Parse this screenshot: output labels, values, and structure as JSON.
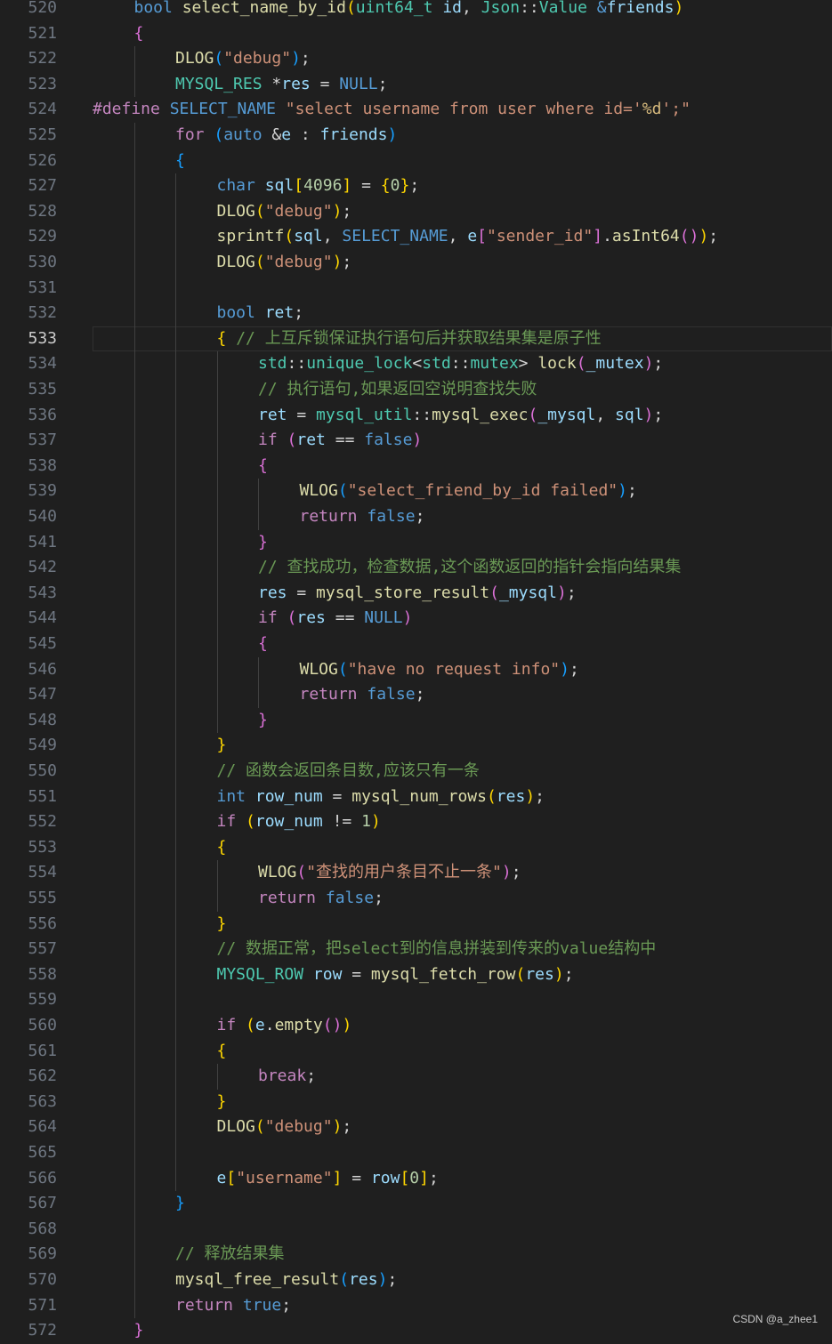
{
  "editor": {
    "current_line": 533,
    "colors": {
      "background": "#1f1f1f",
      "line_number": "#6e7681",
      "keyword": "#569cd6",
      "control": "#c586c0",
      "function": "#dcdcaa",
      "variable": "#9cdcfe",
      "string": "#ce9178",
      "comment": "#6a9955",
      "number": "#b5cea8",
      "type": "#4ec9b0"
    },
    "lines": [
      {
        "n": "520",
        "i": 1,
        "t": [
          [
            "kw",
            "bool"
          ],
          [
            "op",
            " "
          ],
          [
            "fn",
            "select_name_by_id"
          ],
          [
            "p1",
            "("
          ],
          [
            "type",
            "uint64_t"
          ],
          [
            "op",
            " "
          ],
          [
            "var",
            "id"
          ],
          [
            "op",
            ", "
          ],
          [
            "type",
            "Json"
          ],
          [
            "op",
            "::"
          ],
          [
            "type",
            "Value"
          ],
          [
            "op",
            " "
          ],
          [
            "kw",
            "&"
          ],
          [
            "var",
            "friends"
          ],
          [
            "p1",
            ")"
          ]
        ]
      },
      {
        "n": "521",
        "i": 1,
        "t": [
          [
            "p2",
            "{"
          ]
        ]
      },
      {
        "n": "522",
        "i": 2,
        "t": [
          [
            "fn",
            "DLOG"
          ],
          [
            "p3",
            "("
          ],
          [
            "str",
            "\"debug\""
          ],
          [
            "p3",
            ")"
          ],
          [
            "op",
            ";"
          ]
        ]
      },
      {
        "n": "523",
        "i": 2,
        "t": [
          [
            "type",
            "MYSQL_RES"
          ],
          [
            "op",
            " *"
          ],
          [
            "var",
            "res"
          ],
          [
            "op",
            " = "
          ],
          [
            "kw",
            "NULL"
          ],
          [
            "op",
            ";"
          ]
        ]
      },
      {
        "n": "524",
        "i": 0,
        "t": [
          [
            "pre",
            "#define"
          ],
          [
            "op",
            " "
          ],
          [
            "mac",
            "SELECT_NAME"
          ],
          [
            "op",
            " "
          ],
          [
            "str",
            "\"select username from user where id='"
          ],
          [
            "ps",
            "%d"
          ],
          [
            "str",
            "';\""
          ]
        ]
      },
      {
        "n": "525",
        "i": 2,
        "t": [
          [
            "ctl",
            "for"
          ],
          [
            "op",
            " "
          ],
          [
            "p3",
            "("
          ],
          [
            "kw",
            "auto"
          ],
          [
            "op",
            " &"
          ],
          [
            "var",
            "e"
          ],
          [
            "op",
            " : "
          ],
          [
            "var",
            "friends"
          ],
          [
            "p3",
            ")"
          ]
        ]
      },
      {
        "n": "526",
        "i": 2,
        "t": [
          [
            "p3",
            "{"
          ]
        ]
      },
      {
        "n": "527",
        "i": 3,
        "t": [
          [
            "kw",
            "char"
          ],
          [
            "op",
            " "
          ],
          [
            "var",
            "sql"
          ],
          [
            "p1",
            "["
          ],
          [
            "num",
            "4096"
          ],
          [
            "p1",
            "]"
          ],
          [
            "op",
            " = "
          ],
          [
            "p1",
            "{"
          ],
          [
            "num",
            "0"
          ],
          [
            "p1",
            "}"
          ],
          [
            "op",
            ";"
          ]
        ]
      },
      {
        "n": "528",
        "i": 3,
        "t": [
          [
            "fn",
            "DLOG"
          ],
          [
            "p1",
            "("
          ],
          [
            "str",
            "\"debug\""
          ],
          [
            "p1",
            ")"
          ],
          [
            "op",
            ";"
          ]
        ]
      },
      {
        "n": "529",
        "i": 3,
        "t": [
          [
            "fn",
            "sprintf"
          ],
          [
            "p1",
            "("
          ],
          [
            "var",
            "sql"
          ],
          [
            "op",
            ", "
          ],
          [
            "mac",
            "SELECT_NAME"
          ],
          [
            "op",
            ", "
          ],
          [
            "var",
            "e"
          ],
          [
            "p2",
            "["
          ],
          [
            "str",
            "\"sender_id\""
          ],
          [
            "p2",
            "]"
          ],
          [
            "op",
            "."
          ],
          [
            "fn",
            "asInt64"
          ],
          [
            "p2",
            "()"
          ],
          [
            "p1",
            ")"
          ],
          [
            "op",
            ";"
          ]
        ]
      },
      {
        "n": "530",
        "i": 3,
        "t": [
          [
            "fn",
            "DLOG"
          ],
          [
            "p1",
            "("
          ],
          [
            "str",
            "\"debug\""
          ],
          [
            "p1",
            ")"
          ],
          [
            "op",
            ";"
          ]
        ]
      },
      {
        "n": "531",
        "i": 3,
        "t": []
      },
      {
        "n": "532",
        "i": 3,
        "t": [
          [
            "kw",
            "bool"
          ],
          [
            "op",
            " "
          ],
          [
            "var",
            "ret"
          ],
          [
            "op",
            ";"
          ]
        ]
      },
      {
        "n": "533",
        "i": 3,
        "t": [
          [
            "p1",
            "{"
          ],
          [
            "op",
            " "
          ],
          [
            "cm",
            "// 上互斥锁保证执行语句后并获取结果集是原子性"
          ]
        ]
      },
      {
        "n": "534",
        "i": 4,
        "t": [
          [
            "type",
            "std"
          ],
          [
            "op",
            "::"
          ],
          [
            "type",
            "unique_lock"
          ],
          [
            "op",
            "<"
          ],
          [
            "type",
            "std"
          ],
          [
            "op",
            "::"
          ],
          [
            "type",
            "mutex"
          ],
          [
            "op",
            "> "
          ],
          [
            "fn",
            "lock"
          ],
          [
            "p2",
            "("
          ],
          [
            "var",
            "_mutex"
          ],
          [
            "p2",
            ")"
          ],
          [
            "op",
            ";"
          ]
        ]
      },
      {
        "n": "535",
        "i": 4,
        "t": [
          [
            "cm",
            "// 执行语句,如果返回空说明查找失败"
          ]
        ]
      },
      {
        "n": "536",
        "i": 4,
        "t": [
          [
            "var",
            "ret"
          ],
          [
            "op",
            " = "
          ],
          [
            "type",
            "mysql_util"
          ],
          [
            "op",
            "::"
          ],
          [
            "fn",
            "mysql_exec"
          ],
          [
            "p2",
            "("
          ],
          [
            "var",
            "_mysql"
          ],
          [
            "op",
            ", "
          ],
          [
            "var",
            "sql"
          ],
          [
            "p2",
            ")"
          ],
          [
            "op",
            ";"
          ]
        ]
      },
      {
        "n": "537",
        "i": 4,
        "t": [
          [
            "ctl",
            "if"
          ],
          [
            "op",
            " "
          ],
          [
            "p2",
            "("
          ],
          [
            "var",
            "ret"
          ],
          [
            "op",
            " == "
          ],
          [
            "kw",
            "false"
          ],
          [
            "p2",
            ")"
          ]
        ]
      },
      {
        "n": "538",
        "i": 4,
        "t": [
          [
            "p2",
            "{"
          ]
        ]
      },
      {
        "n": "539",
        "i": 5,
        "t": [
          [
            "fn",
            "WLOG"
          ],
          [
            "p3",
            "("
          ],
          [
            "str",
            "\"select_friend_by_id failed\""
          ],
          [
            "p3",
            ")"
          ],
          [
            "op",
            ";"
          ]
        ]
      },
      {
        "n": "540",
        "i": 5,
        "t": [
          [
            "ctl",
            "return"
          ],
          [
            "op",
            " "
          ],
          [
            "kw",
            "false"
          ],
          [
            "op",
            ";"
          ]
        ]
      },
      {
        "n": "541",
        "i": 4,
        "t": [
          [
            "p2",
            "}"
          ]
        ]
      },
      {
        "n": "542",
        "i": 4,
        "t": [
          [
            "cm",
            "// 查找成功，检查数据,这个函数返回的指针会指向结果集"
          ]
        ]
      },
      {
        "n": "543",
        "i": 4,
        "t": [
          [
            "var",
            "res"
          ],
          [
            "op",
            " = "
          ],
          [
            "fn",
            "mysql_store_result"
          ],
          [
            "p2",
            "("
          ],
          [
            "var",
            "_mysql"
          ],
          [
            "p2",
            ")"
          ],
          [
            "op",
            ";"
          ]
        ]
      },
      {
        "n": "544",
        "i": 4,
        "t": [
          [
            "ctl",
            "if"
          ],
          [
            "op",
            " "
          ],
          [
            "p2",
            "("
          ],
          [
            "var",
            "res"
          ],
          [
            "op",
            " == "
          ],
          [
            "kw",
            "NULL"
          ],
          [
            "p2",
            ")"
          ]
        ]
      },
      {
        "n": "545",
        "i": 4,
        "t": [
          [
            "p2",
            "{"
          ]
        ]
      },
      {
        "n": "546",
        "i": 5,
        "t": [
          [
            "fn",
            "WLOG"
          ],
          [
            "p3",
            "("
          ],
          [
            "str",
            "\"have no request info\""
          ],
          [
            "p3",
            ")"
          ],
          [
            "op",
            ";"
          ]
        ]
      },
      {
        "n": "547",
        "i": 5,
        "t": [
          [
            "ctl",
            "return"
          ],
          [
            "op",
            " "
          ],
          [
            "kw",
            "false"
          ],
          [
            "op",
            ";"
          ]
        ]
      },
      {
        "n": "548",
        "i": 4,
        "t": [
          [
            "p2",
            "}"
          ]
        ]
      },
      {
        "n": "549",
        "i": 3,
        "t": [
          [
            "p1",
            "}"
          ]
        ]
      },
      {
        "n": "550",
        "i": 3,
        "t": [
          [
            "cm",
            "// 函数会返回条目数,应该只有一条"
          ]
        ]
      },
      {
        "n": "551",
        "i": 3,
        "t": [
          [
            "kw",
            "int"
          ],
          [
            "op",
            " "
          ],
          [
            "var",
            "row_num"
          ],
          [
            "op",
            " = "
          ],
          [
            "fn",
            "mysql_num_rows"
          ],
          [
            "p1",
            "("
          ],
          [
            "var",
            "res"
          ],
          [
            "p1",
            ")"
          ],
          [
            "op",
            ";"
          ]
        ]
      },
      {
        "n": "552",
        "i": 3,
        "t": [
          [
            "ctl",
            "if"
          ],
          [
            "op",
            " "
          ],
          [
            "p1",
            "("
          ],
          [
            "var",
            "row_num"
          ],
          [
            "op",
            " != "
          ],
          [
            "num",
            "1"
          ],
          [
            "p1",
            ")"
          ]
        ]
      },
      {
        "n": "553",
        "i": 3,
        "t": [
          [
            "p1",
            "{"
          ]
        ]
      },
      {
        "n": "554",
        "i": 4,
        "t": [
          [
            "fn",
            "WLOG"
          ],
          [
            "p2",
            "("
          ],
          [
            "str",
            "\"查找的用户条目不止一条\""
          ],
          [
            "p2",
            ")"
          ],
          [
            "op",
            ";"
          ]
        ]
      },
      {
        "n": "555",
        "i": 4,
        "t": [
          [
            "ctl",
            "return"
          ],
          [
            "op",
            " "
          ],
          [
            "kw",
            "false"
          ],
          [
            "op",
            ";"
          ]
        ]
      },
      {
        "n": "556",
        "i": 3,
        "t": [
          [
            "p1",
            "}"
          ]
        ]
      },
      {
        "n": "557",
        "i": 3,
        "t": [
          [
            "cm",
            "// 数据正常，把select到的信息拼装到传来的value结构中"
          ]
        ]
      },
      {
        "n": "558",
        "i": 3,
        "t": [
          [
            "type",
            "MYSQL_ROW"
          ],
          [
            "op",
            " "
          ],
          [
            "var",
            "row"
          ],
          [
            "op",
            " = "
          ],
          [
            "fn",
            "mysql_fetch_row"
          ],
          [
            "p1",
            "("
          ],
          [
            "var",
            "res"
          ],
          [
            "p1",
            ")"
          ],
          [
            "op",
            ";"
          ]
        ]
      },
      {
        "n": "559",
        "i": 3,
        "t": []
      },
      {
        "n": "560",
        "i": 3,
        "t": [
          [
            "ctl",
            "if"
          ],
          [
            "op",
            " "
          ],
          [
            "p1",
            "("
          ],
          [
            "var",
            "e"
          ],
          [
            "op",
            "."
          ],
          [
            "fn",
            "empty"
          ],
          [
            "p2",
            "()"
          ],
          [
            "p1",
            ")"
          ]
        ]
      },
      {
        "n": "561",
        "i": 3,
        "t": [
          [
            "p1",
            "{"
          ]
        ]
      },
      {
        "n": "562",
        "i": 4,
        "t": [
          [
            "ctl",
            "break"
          ],
          [
            "op",
            ";"
          ]
        ]
      },
      {
        "n": "563",
        "i": 3,
        "t": [
          [
            "p1",
            "}"
          ]
        ]
      },
      {
        "n": "564",
        "i": 3,
        "t": [
          [
            "fn",
            "DLOG"
          ],
          [
            "p1",
            "("
          ],
          [
            "str",
            "\"debug\""
          ],
          [
            "p1",
            ")"
          ],
          [
            "op",
            ";"
          ]
        ]
      },
      {
        "n": "565",
        "i": 3,
        "t": []
      },
      {
        "n": "566",
        "i": 3,
        "t": [
          [
            "var",
            "e"
          ],
          [
            "p1",
            "["
          ],
          [
            "str",
            "\"username\""
          ],
          [
            "p1",
            "]"
          ],
          [
            "op",
            " = "
          ],
          [
            "var",
            "row"
          ],
          [
            "p1",
            "["
          ],
          [
            "num",
            "0"
          ],
          [
            "p1",
            "]"
          ],
          [
            "op",
            ";"
          ]
        ]
      },
      {
        "n": "567",
        "i": 2,
        "t": [
          [
            "p3",
            "}"
          ]
        ]
      },
      {
        "n": "568",
        "i": 2,
        "t": []
      },
      {
        "n": "569",
        "i": 2,
        "t": [
          [
            "cm",
            "// 释放结果集"
          ]
        ]
      },
      {
        "n": "570",
        "i": 2,
        "t": [
          [
            "fn",
            "mysql_free_result"
          ],
          [
            "p3",
            "("
          ],
          [
            "var",
            "res"
          ],
          [
            "p3",
            ")"
          ],
          [
            "op",
            ";"
          ]
        ]
      },
      {
        "n": "571",
        "i": 2,
        "t": [
          [
            "ctl",
            "return"
          ],
          [
            "op",
            " "
          ],
          [
            "kw",
            "true"
          ],
          [
            "op",
            ";"
          ]
        ]
      },
      {
        "n": "572",
        "i": 1,
        "t": [
          [
            "p2",
            "}"
          ]
        ]
      }
    ]
  },
  "watermark": "CSDN @a_zhee1"
}
